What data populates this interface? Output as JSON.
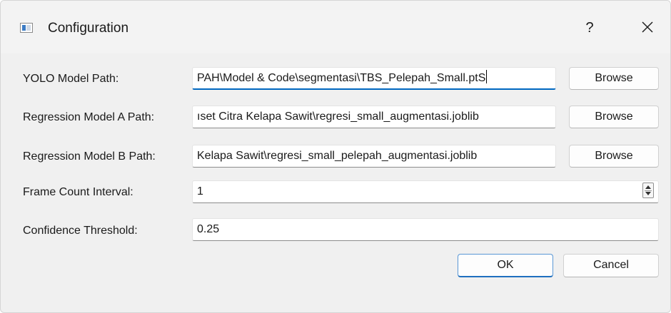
{
  "window": {
    "title": "Configuration",
    "help_label": "?",
    "close_icon": "close-icon",
    "app_icon": "window-app-icon"
  },
  "fields": {
    "yolo": {
      "label": "YOLO Model Path:",
      "value": "PAH\\Model & Code\\segmentasi\\TBS_Pelepah_Small.ptS",
      "button": "Browse"
    },
    "regA": {
      "label": "Regression Model A Path:",
      "value": "ıset Citra Kelapa Sawit\\regresi_small_augmentasi.joblib",
      "button": "Browse"
    },
    "regB": {
      "label": "Regression Model B Path:",
      "value": "Kelapa Sawit\\regresi_small_pelepah_augmentasi.joblib",
      "button": "Browse"
    },
    "frame": {
      "label": "Frame Count Interval:",
      "value": "1"
    },
    "confidence": {
      "label": "Confidence Threshold:",
      "value": "0.25"
    }
  },
  "actions": {
    "ok": "OK",
    "cancel": "Cancel"
  },
  "colors": {
    "accent": "#0067c0",
    "background": "#f0f0f0"
  }
}
